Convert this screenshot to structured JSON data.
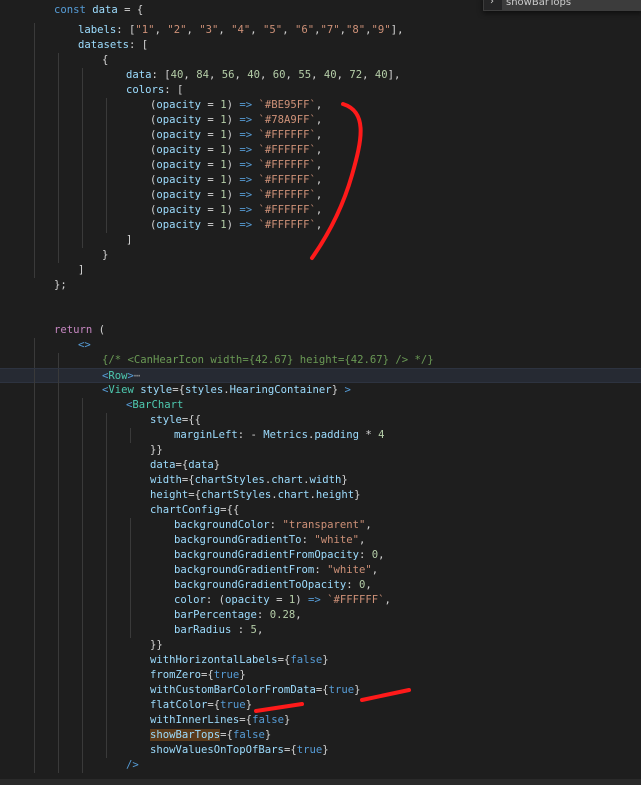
{
  "search": {
    "query": "showBarTops"
  },
  "annotation_color": "#ff1a1a",
  "lines": [
    {
      "t": 10,
      "indent": 1,
      "tokens": [
        [
          "kw",
          "const"
        ],
        [
          "punct",
          " "
        ],
        [
          "var",
          "data"
        ],
        [
          "punct",
          " = {"
        ]
      ]
    },
    {
      "t": 30,
      "indent": 2,
      "tokens": [
        [
          "var",
          "labels"
        ],
        [
          "punct",
          ": ["
        ],
        [
          "str",
          "\"1\""
        ],
        [
          "punct",
          ", "
        ],
        [
          "str",
          "\"2\""
        ],
        [
          "punct",
          ", "
        ],
        [
          "str",
          "\"3\""
        ],
        [
          "punct",
          ", "
        ],
        [
          "str",
          "\"4\""
        ],
        [
          "punct",
          ", "
        ],
        [
          "str",
          "\"5\""
        ],
        [
          "punct",
          ", "
        ],
        [
          "str",
          "\"6\""
        ],
        [
          "punct",
          ","
        ],
        [
          "str",
          "\"7\""
        ],
        [
          "punct",
          ","
        ],
        [
          "str",
          "\"8\""
        ],
        [
          "punct",
          ","
        ],
        [
          "str",
          "\"9\""
        ],
        [
          "punct",
          "],"
        ]
      ]
    },
    {
      "t": 45,
      "indent": 2,
      "tokens": [
        [
          "var",
          "datasets"
        ],
        [
          "punct",
          ": ["
        ]
      ]
    },
    {
      "t": 60,
      "indent": 3,
      "tokens": [
        [
          "punct",
          "{"
        ]
      ]
    },
    {
      "t": 75,
      "indent": 4,
      "tokens": [
        [
          "var",
          "data"
        ],
        [
          "punct",
          ": ["
        ],
        [
          "num",
          "40"
        ],
        [
          "punct",
          ", "
        ],
        [
          "num",
          "84"
        ],
        [
          "punct",
          ", "
        ],
        [
          "num",
          "56"
        ],
        [
          "punct",
          ", "
        ],
        [
          "num",
          "40"
        ],
        [
          "punct",
          ", "
        ],
        [
          "num",
          "60"
        ],
        [
          "punct",
          ", "
        ],
        [
          "num",
          "55"
        ],
        [
          "punct",
          ", "
        ],
        [
          "num",
          "40"
        ],
        [
          "punct",
          ", "
        ],
        [
          "num",
          "72"
        ],
        [
          "punct",
          ", "
        ],
        [
          "num",
          "40"
        ],
        [
          "punct",
          "],"
        ]
      ]
    },
    {
      "t": 90,
      "indent": 4,
      "tokens": [
        [
          "var",
          "colors"
        ],
        [
          "punct",
          ": ["
        ]
      ]
    },
    {
      "t": 105,
      "indent": 5,
      "tokens": [
        [
          "punct",
          "("
        ],
        [
          "var",
          "opacity"
        ],
        [
          "punct",
          " = "
        ],
        [
          "num",
          "1"
        ],
        [
          "punct",
          ") "
        ],
        [
          "kw",
          "=>"
        ],
        [
          "punct",
          " "
        ],
        [
          "str",
          "`#BE95FF`"
        ],
        [
          "punct",
          ","
        ]
      ]
    },
    {
      "t": 120,
      "indent": 5,
      "tokens": [
        [
          "punct",
          "("
        ],
        [
          "var",
          "opacity"
        ],
        [
          "punct",
          " = "
        ],
        [
          "num",
          "1"
        ],
        [
          "punct",
          ") "
        ],
        [
          "kw",
          "=>"
        ],
        [
          "punct",
          " "
        ],
        [
          "str",
          "`#78A9FF`"
        ],
        [
          "punct",
          ","
        ]
      ]
    },
    {
      "t": 135,
      "indent": 5,
      "tokens": [
        [
          "punct",
          "("
        ],
        [
          "var",
          "opacity"
        ],
        [
          "punct",
          " = "
        ],
        [
          "num",
          "1"
        ],
        [
          "punct",
          ") "
        ],
        [
          "kw",
          "=>"
        ],
        [
          "punct",
          " "
        ],
        [
          "str",
          "`#FFFFFF`"
        ],
        [
          "punct",
          ","
        ]
      ]
    },
    {
      "t": 150,
      "indent": 5,
      "tokens": [
        [
          "punct",
          "("
        ],
        [
          "var",
          "opacity"
        ],
        [
          "punct",
          " = "
        ],
        [
          "num",
          "1"
        ],
        [
          "punct",
          ") "
        ],
        [
          "kw",
          "=>"
        ],
        [
          "punct",
          " "
        ],
        [
          "str",
          "`#FFFFFF`"
        ],
        [
          "punct",
          ","
        ]
      ]
    },
    {
      "t": 165,
      "indent": 5,
      "tokens": [
        [
          "punct",
          "("
        ],
        [
          "var",
          "opacity"
        ],
        [
          "punct",
          " = "
        ],
        [
          "num",
          "1"
        ],
        [
          "punct",
          ") "
        ],
        [
          "kw",
          "=>"
        ],
        [
          "punct",
          " "
        ],
        [
          "str",
          "`#FFFFFF`"
        ],
        [
          "punct",
          ","
        ]
      ]
    },
    {
      "t": 180,
      "indent": 5,
      "tokens": [
        [
          "punct",
          "("
        ],
        [
          "var",
          "opacity"
        ],
        [
          "punct",
          " = "
        ],
        [
          "num",
          "1"
        ],
        [
          "punct",
          ") "
        ],
        [
          "kw",
          "=>"
        ],
        [
          "punct",
          " "
        ],
        [
          "str",
          "`#FFFFFF`"
        ],
        [
          "punct",
          ","
        ]
      ]
    },
    {
      "t": 195,
      "indent": 5,
      "tokens": [
        [
          "punct",
          "("
        ],
        [
          "var",
          "opacity"
        ],
        [
          "punct",
          " = "
        ],
        [
          "num",
          "1"
        ],
        [
          "punct",
          ") "
        ],
        [
          "kw",
          "=>"
        ],
        [
          "punct",
          " "
        ],
        [
          "str",
          "`#FFFFFF`"
        ],
        [
          "punct",
          ","
        ]
      ]
    },
    {
      "t": 210,
      "indent": 5,
      "tokens": [
        [
          "punct",
          "("
        ],
        [
          "var",
          "opacity"
        ],
        [
          "punct",
          " = "
        ],
        [
          "num",
          "1"
        ],
        [
          "punct",
          ") "
        ],
        [
          "kw",
          "=>"
        ],
        [
          "punct",
          " "
        ],
        [
          "str",
          "`#FFFFFF`"
        ],
        [
          "punct",
          ","
        ]
      ]
    },
    {
      "t": 225,
      "indent": 5,
      "tokens": [
        [
          "punct",
          "("
        ],
        [
          "var",
          "opacity"
        ],
        [
          "punct",
          " = "
        ],
        [
          "num",
          "1"
        ],
        [
          "punct",
          ") "
        ],
        [
          "kw",
          "=>"
        ],
        [
          "punct",
          " "
        ],
        [
          "str",
          "`#FFFFFF`"
        ],
        [
          "punct",
          ","
        ]
      ]
    },
    {
      "t": 240,
      "indent": 4,
      "tokens": [
        [
          "punct",
          "]"
        ]
      ]
    },
    {
      "t": 255,
      "indent": 3,
      "tokens": [
        [
          "punct",
          "}"
        ]
      ]
    },
    {
      "t": 270,
      "indent": 2,
      "tokens": [
        [
          "punct",
          "]"
        ]
      ]
    },
    {
      "t": 285,
      "indent": 1,
      "tokens": [
        [
          "punct",
          "};"
        ]
      ]
    },
    {
      "t": 330,
      "indent": 1,
      "tokens": [
        [
          "ctrl",
          "return"
        ],
        [
          "punct",
          " ("
        ]
      ]
    },
    {
      "t": 345,
      "indent": 2,
      "tokens": [
        [
          "tagb",
          "<>"
        ]
      ]
    },
    {
      "t": 360,
      "indent": 3,
      "tokens": [
        [
          "comment",
          "{/* <CanHearIcon width={42.67} height={42.67} /> */}"
        ]
      ]
    },
    {
      "t": 375,
      "indent": 3,
      "cursor": true,
      "tokens": [
        [
          "tagb",
          "<"
        ],
        [
          "tag",
          "Row"
        ],
        [
          "tagb",
          ">"
        ],
        [
          "fold",
          "⋯"
        ]
      ]
    },
    {
      "t": 390,
      "indent": 3,
      "tokens": [
        [
          "tagb",
          "<"
        ],
        [
          "tag",
          "View"
        ],
        [
          "punct",
          " "
        ],
        [
          "attr",
          "style"
        ],
        [
          "punct",
          "={"
        ],
        [
          "var",
          "styles"
        ],
        [
          "punct",
          "."
        ],
        [
          "var",
          "HearingContainer"
        ],
        [
          "punct",
          "} "
        ],
        [
          "tagb",
          ">"
        ]
      ]
    },
    {
      "t": 405,
      "indent": 4,
      "tokens": [
        [
          "tagb",
          "<"
        ],
        [
          "tag",
          "BarChart"
        ]
      ]
    },
    {
      "t": 420,
      "indent": 5,
      "tokens": [
        [
          "attr",
          "style"
        ],
        [
          "punct",
          "={{"
        ]
      ]
    },
    {
      "t": 435,
      "indent": 6,
      "tokens": [
        [
          "var",
          "marginLeft"
        ],
        [
          "punct",
          ": - "
        ],
        [
          "var",
          "Metrics"
        ],
        [
          "punct",
          "."
        ],
        [
          "var",
          "padding"
        ],
        [
          "punct",
          " * "
        ],
        [
          "num",
          "4"
        ]
      ]
    },
    {
      "t": 450,
      "indent": 5,
      "tokens": [
        [
          "punct",
          "}}"
        ]
      ]
    },
    {
      "t": 465,
      "indent": 5,
      "tokens": [
        [
          "attr",
          "data"
        ],
        [
          "punct",
          "={"
        ],
        [
          "var",
          "data"
        ],
        [
          "punct",
          "}"
        ]
      ]
    },
    {
      "t": 480,
      "indent": 5,
      "tokens": [
        [
          "attr",
          "width"
        ],
        [
          "punct",
          "={"
        ],
        [
          "var",
          "chartStyles"
        ],
        [
          "punct",
          "."
        ],
        [
          "var",
          "chart"
        ],
        [
          "punct",
          "."
        ],
        [
          "var",
          "width"
        ],
        [
          "punct",
          "}"
        ]
      ]
    },
    {
      "t": 495,
      "indent": 5,
      "tokens": [
        [
          "attr",
          "height"
        ],
        [
          "punct",
          "={"
        ],
        [
          "var",
          "chartStyles"
        ],
        [
          "punct",
          "."
        ],
        [
          "var",
          "chart"
        ],
        [
          "punct",
          "."
        ],
        [
          "var",
          "height"
        ],
        [
          "punct",
          "}"
        ]
      ]
    },
    {
      "t": 510,
      "indent": 5,
      "tokens": [
        [
          "attr",
          "chartConfig"
        ],
        [
          "punct",
          "="
        ],
        [
          "punct",
          "{"
        ],
        [
          "punct",
          "{"
        ]
      ]
    },
    {
      "t": 525,
      "indent": 6,
      "tokens": [
        [
          "var",
          "backgroundColor"
        ],
        [
          "punct",
          ": "
        ],
        [
          "str",
          "\"transparent\""
        ],
        [
          "punct",
          ","
        ]
      ]
    },
    {
      "t": 540,
      "indent": 6,
      "tokens": [
        [
          "var",
          "backgroundGradientTo"
        ],
        [
          "punct",
          ": "
        ],
        [
          "str",
          "\"white\""
        ],
        [
          "punct",
          ","
        ]
      ]
    },
    {
      "t": 555,
      "indent": 6,
      "tokens": [
        [
          "var",
          "backgroundGradientFromOpacity"
        ],
        [
          "punct",
          ": "
        ],
        [
          "num",
          "0"
        ],
        [
          "punct",
          ","
        ]
      ]
    },
    {
      "t": 570,
      "indent": 6,
      "tokens": [
        [
          "var",
          "backgroundGradientFrom"
        ],
        [
          "punct",
          ": "
        ],
        [
          "str",
          "\"white\""
        ],
        [
          "punct",
          ","
        ]
      ]
    },
    {
      "t": 585,
      "indent": 6,
      "tokens": [
        [
          "var",
          "backgroundGradientToOpacity"
        ],
        [
          "punct",
          ": "
        ],
        [
          "num",
          "0"
        ],
        [
          "punct",
          ","
        ]
      ]
    },
    {
      "t": 600,
      "indent": 6,
      "tokens": [
        [
          "var",
          "color"
        ],
        [
          "punct",
          ": ("
        ],
        [
          "var",
          "opacity"
        ],
        [
          "punct",
          " = "
        ],
        [
          "num",
          "1"
        ],
        [
          "punct",
          ") "
        ],
        [
          "kw",
          "=>"
        ],
        [
          "punct",
          " "
        ],
        [
          "str",
          "`#FFFFFF`"
        ],
        [
          "punct",
          ","
        ]
      ]
    },
    {
      "t": 615,
      "indent": 6,
      "tokens": [
        [
          "var",
          "barPercentage"
        ],
        [
          "punct",
          ": "
        ],
        [
          "num",
          "0.28"
        ],
        [
          "punct",
          ","
        ]
      ]
    },
    {
      "t": 630,
      "indent": 6,
      "tokens": [
        [
          "var",
          "barRadius"
        ],
        [
          "punct",
          " : "
        ],
        [
          "num",
          "5"
        ],
        [
          "punct",
          ","
        ]
      ]
    },
    {
      "t": 645,
      "indent": 5,
      "tokens": [
        [
          "punct",
          "}"
        ],
        [
          "punct",
          "}"
        ]
      ]
    },
    {
      "t": 660,
      "indent": 5,
      "tokens": [
        [
          "attr",
          "withHorizontalLabels"
        ],
        [
          "punct",
          "={"
        ],
        [
          "kw",
          "false"
        ],
        [
          "punct",
          "}"
        ]
      ]
    },
    {
      "t": 675,
      "indent": 5,
      "tokens": [
        [
          "attr",
          "fromZero"
        ],
        [
          "punct",
          "={"
        ],
        [
          "kw",
          "true"
        ],
        [
          "punct",
          "}"
        ]
      ]
    },
    {
      "t": 690,
      "indent": 5,
      "tokens": [
        [
          "attr",
          "withCustomBarColorFromData"
        ],
        [
          "punct",
          "={"
        ],
        [
          "kw",
          "true"
        ],
        [
          "punct",
          "}"
        ]
      ]
    },
    {
      "t": 705,
      "indent": 5,
      "tokens": [
        [
          "attr",
          "flatColor"
        ],
        [
          "punct",
          "={"
        ],
        [
          "kw",
          "true"
        ],
        [
          "punct",
          "}"
        ]
      ]
    },
    {
      "t": 720,
      "indent": 5,
      "tokens": [
        [
          "attr",
          "withInnerLines"
        ],
        [
          "punct",
          "={"
        ],
        [
          "kw",
          "false"
        ],
        [
          "punct",
          "}"
        ]
      ]
    },
    {
      "t": 735,
      "indent": 5,
      "tokens": [
        [
          "attr hl",
          "showBarTops"
        ],
        [
          "punct",
          "={"
        ],
        [
          "kw",
          "false"
        ],
        [
          "punct",
          "}"
        ]
      ]
    },
    {
      "t": 750,
      "indent": 5,
      "tokens": [
        [
          "attr",
          "showValuesOnTopOfBars"
        ],
        [
          "punct",
          "={"
        ],
        [
          "kw",
          "true"
        ],
        [
          "punct",
          "}"
        ]
      ]
    },
    {
      "t": 765,
      "indent": 4,
      "tokens": [
        [
          "tagb",
          "/>"
        ]
      ]
    }
  ]
}
